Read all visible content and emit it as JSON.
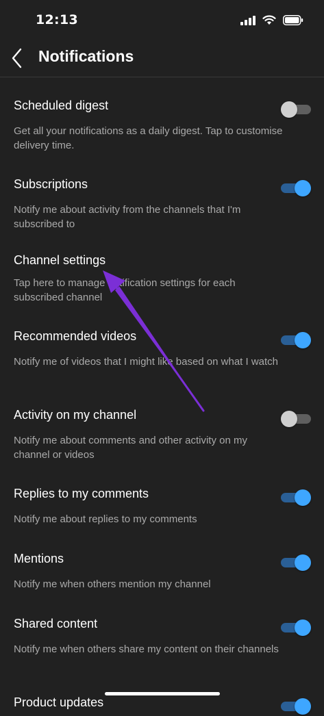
{
  "status_bar": {
    "time": "12:13"
  },
  "header": {
    "title": "Notifications"
  },
  "settings": [
    {
      "title": "Scheduled digest",
      "desc": "Get all your notifications as a daily digest. Tap to customise delivery time.",
      "toggle": "off"
    },
    {
      "title": "Subscriptions",
      "desc": "Notify me about activity from the channels that I'm subscribed to",
      "toggle": "on"
    },
    {
      "title": "Channel settings",
      "desc": "Tap here to manage notification settings for each subscribed channel"
    },
    {
      "title": "Recommended videos",
      "desc": "Notify me of videos that I might like based on what I watch",
      "toggle": "on"
    },
    {
      "title": "Activity on my channel",
      "desc": "Notify me about comments and other activity on my channel or videos",
      "toggle": "off"
    },
    {
      "title": "Replies to my comments",
      "desc": "Notify me about replies to my comments",
      "toggle": "on"
    },
    {
      "title": "Mentions",
      "desc": "Notify me when others mention my channel",
      "toggle": "on"
    },
    {
      "title": "Shared content",
      "desc": "Notify me when others share my content on their channels",
      "toggle": "on"
    },
    {
      "title": "Product updates",
      "desc": "",
      "toggle": "on"
    }
  ],
  "colors": {
    "accent": "#3ea6ff",
    "annotation_arrow": "#7b2fd6",
    "background": "#212121"
  }
}
